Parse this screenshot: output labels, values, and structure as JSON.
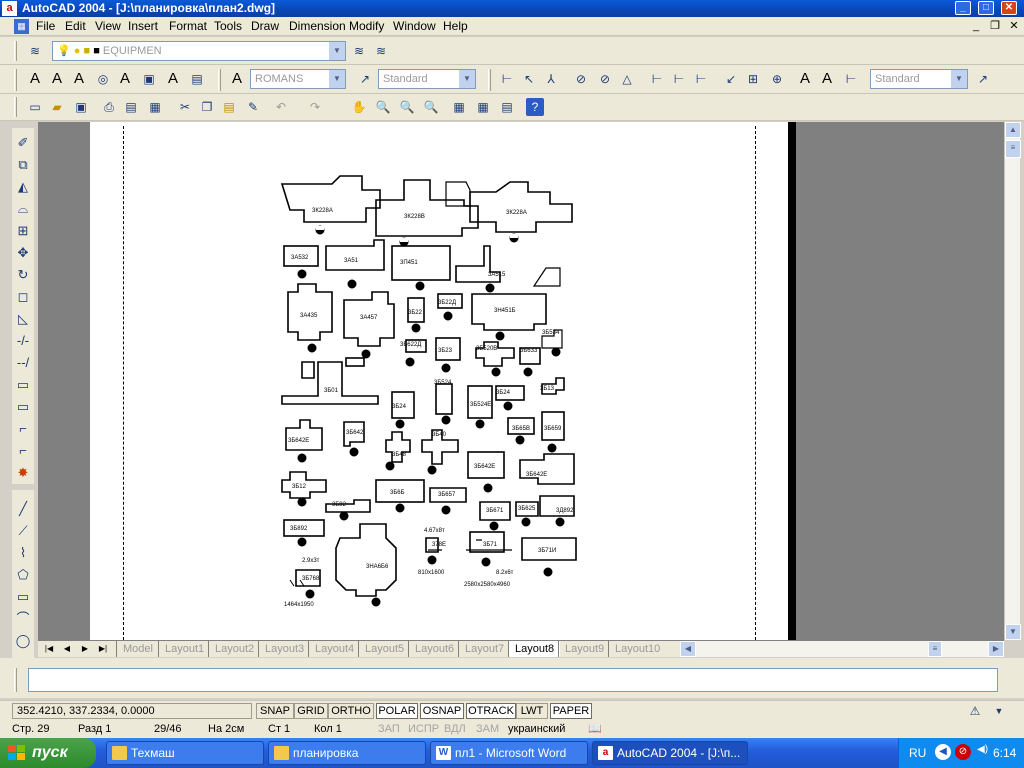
{
  "window": {
    "title": "AutoCAD 2004 - [J:\\планировка\\план2.dwg]",
    "controls": {
      "minimize": "_",
      "maximize": "□",
      "close": "✕"
    }
  },
  "menu": {
    "items": [
      "File",
      "Edit",
      "View",
      "Insert",
      "Format",
      "Tools",
      "Draw",
      "Dimension",
      "Modify",
      "Window",
      "Help"
    ],
    "mdi": {
      "minimize": "_",
      "restore": "❐",
      "close": "✕"
    }
  },
  "toolbars": {
    "layer_combo": "EQUIPMEN",
    "text_style_combo": "ROMANS",
    "dim_style_combo": "Standard",
    "dim_style_combo2": "Standard"
  },
  "tabs": {
    "items": [
      "Model",
      "Layout1",
      "Layout2",
      "Layout3",
      "Layout4",
      "Layout5",
      "Layout6",
      "Layout7",
      "Layout8",
      "Layout9",
      "Layout10"
    ],
    "active": "Layout8"
  },
  "drawing": {
    "labels": [
      "3К228А",
      "3К228В",
      "3К228А",
      "3А532",
      "3А51",
      "3П451",
      "3А515",
      "3А435",
      "3А457",
      "3Б22",
      "3Б22Д",
      "3Н451Б",
      "3Б534",
      "3Б622Д",
      "3Б23",
      "3Б520В",
      "3Б633",
      "3Б01",
      "3Б524",
      "3Б24",
      "3Б524Е",
      "3Б24",
      "3Б13",
      "3Б642Е",
      "3Б642",
      "3Б48",
      "3Б40",
      "3Б642Е",
      "3Б65В",
      "3Б659",
      "3Б12",
      "3Б6Б",
      "3Б657",
      "3Б642Е",
      "3Б82",
      "3Б01",
      "3Б671",
      "3Б625",
      "3Д892",
      "3Б892",
      "3НА6Б6",
      "378Е",
      "3Б71",
      "3Б71И",
      "3Б768"
    ],
    "annotations": [
      "2.9х3т",
      "4.67х8т",
      "810х1600",
      "8.2х6т",
      "2580х2580х4960",
      "1464х1950"
    ]
  },
  "status": {
    "coords": "352.4210, 337.2334, 0.0000",
    "buttons": [
      {
        "label": "SNAP",
        "on": false
      },
      {
        "label": "GRID",
        "on": false
      },
      {
        "label": "ORTHO",
        "on": false
      },
      {
        "label": "POLAR",
        "on": true
      },
      {
        "label": "OSNAP",
        "on": true
      },
      {
        "label": "OTRACK",
        "on": true
      },
      {
        "label": "LWT",
        "on": false
      },
      {
        "label": "PAPER",
        "on": true
      }
    ]
  },
  "inforow": {
    "page": "Стр. 29",
    "section": "Разд 1",
    "pages": "29/46",
    "at": "На 2см",
    "line": "Ст 1",
    "col": "Кол 1",
    "rec": "ЗАП",
    "trk": "ИСПР",
    "ext": "ВДЛ",
    "ovr": "ЗАМ",
    "lang": "украинский"
  },
  "taskbar": {
    "start": "пуск",
    "tasks": [
      {
        "label": "Техмаш",
        "icon": "folder-icon",
        "active": false
      },
      {
        "label": "планировка",
        "icon": "folder-icon",
        "active": false
      },
      {
        "label": "пл1 - Microsoft Word",
        "icon": "word-icon",
        "active": false
      },
      {
        "label": "AutoCAD 2004 - [J:\\п...",
        "icon": "autocad-icon",
        "active": true
      }
    ],
    "lang": "RU",
    "time": "6:14"
  },
  "colors": {
    "accent": "#245edc",
    "start": "#2d8a2d",
    "paper": "#ffffff",
    "modelspace": "#808080"
  }
}
